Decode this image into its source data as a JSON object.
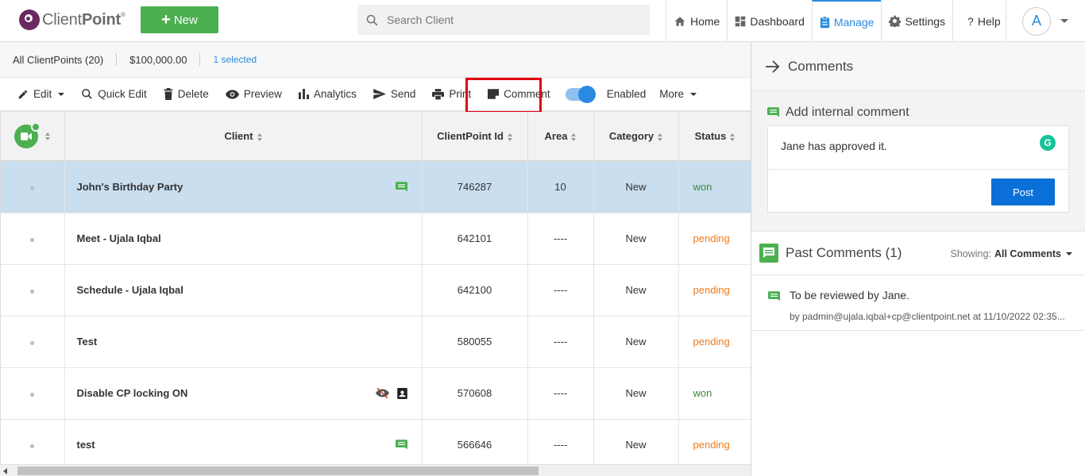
{
  "header": {
    "logo_text_light": "Client",
    "logo_text_bold": "Point",
    "logo_reg": "®",
    "new_label": "New",
    "search_placeholder": "Search Client",
    "nav": [
      {
        "label": "Home",
        "icon": "home-icon"
      },
      {
        "label": "Dashboard",
        "icon": "dashboard-icon"
      },
      {
        "label": "Manage",
        "icon": "clipboard-icon",
        "active": true
      },
      {
        "label": "Settings",
        "icon": "gear-icon"
      },
      {
        "label": "Help",
        "icon": "question-icon"
      }
    ],
    "avatar_initial": "A"
  },
  "summary": {
    "all_label": "All ClientPoints (20)",
    "total_value": "$100,000.00",
    "selected_label": "1 selected"
  },
  "toolbar": {
    "edit": "Edit",
    "quick_edit": "Quick Edit",
    "delete": "Delete",
    "preview": "Preview",
    "analytics": "Analytics",
    "send": "Send",
    "print": "Print",
    "comment": "Comment",
    "enabled": "Enabled",
    "more": "More"
  },
  "table": {
    "columns": [
      "Client",
      "ClientPoint Id",
      "Area",
      "Category",
      "Status"
    ],
    "rows": [
      {
        "client": "John's Birthday Party",
        "id": "746287",
        "area": "10",
        "category": "New",
        "status": "won",
        "selected": true,
        "icons": [
          "comment-icon"
        ]
      },
      {
        "client": "Meet - Ujala Iqbal",
        "id": "642101",
        "area": "----",
        "category": "New",
        "status": "pending",
        "icons": []
      },
      {
        "client": "Schedule - Ujala Iqbal",
        "id": "642100",
        "area": "----",
        "category": "New",
        "status": "pending",
        "icons": []
      },
      {
        "client": "Test",
        "id": "580055",
        "area": "----",
        "category": "New",
        "status": "pending",
        "icons": []
      },
      {
        "client": "Disable CP locking ON",
        "id": "570608",
        "area": "----",
        "category": "New",
        "status": "won",
        "icons": [
          "eye-off-icon",
          "contact-icon"
        ]
      },
      {
        "client": "test",
        "id": "566646",
        "area": "----",
        "category": "New",
        "status": "pending",
        "icons": [
          "comment-icon"
        ]
      }
    ]
  },
  "panel": {
    "title": "Comments",
    "add_title": "Add internal comment",
    "draft_comment": "Jane has approved it.",
    "grammarly_letter": "G",
    "post_label": "Post",
    "past_title": "Past Comments (1)",
    "showing_label": "Showing:",
    "showing_value": "All Comments",
    "past_comments": [
      {
        "text": "To be reviewed by Jane.",
        "meta": "by padmin@ujala.iqbal+cp@clientpoint.net at 11/10/2022 02:35..."
      }
    ]
  },
  "colors": {
    "brand_purple": "#6b2a5f",
    "new_green": "#4caf50",
    "accent_blue": "#2a8ae0",
    "post_blue": "#0a6fd6",
    "won_green": "#3a8a3a",
    "pending_orange": "#f07a1a",
    "highlight_red": "#e0000f",
    "selected_row": "#c9deef"
  }
}
